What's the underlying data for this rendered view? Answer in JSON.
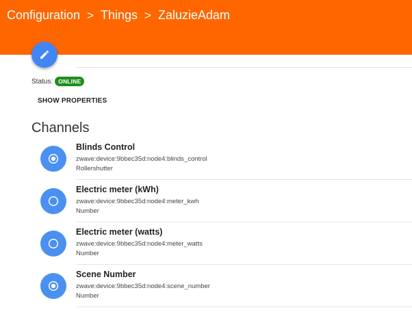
{
  "header": {
    "crumbs": [
      "Configuration",
      "Things",
      "ZaluzieAdam"
    ],
    "separator": ">",
    "bg_color": "#ff6600"
  },
  "fab": {
    "icon": "pencil-icon",
    "color": "#4285f4"
  },
  "status": {
    "label": "Status:",
    "value": "ONLINE",
    "color": "#1e8e1e"
  },
  "show_properties_label": "SHOW PROPERTIES",
  "channels_title": "Channels",
  "channels": [
    {
      "name": "Blinds Control",
      "uid": "zwave:device:9bbec35d:node4:blinds_control",
      "type": "Rollershutter",
      "linked": true
    },
    {
      "name": "Electric meter (kWh)",
      "uid": "zwave:device:9bbec35d:node4:meter_kwh",
      "type": "Number",
      "linked": false
    },
    {
      "name": "Electric meter (watts)",
      "uid": "zwave:device:9bbec35d:node4:meter_watts",
      "type": "Number",
      "linked": false
    },
    {
      "name": "Scene Number",
      "uid": "zwave:device:9bbec35d:node4:scene_number",
      "type": "Number",
      "linked": true
    }
  ]
}
